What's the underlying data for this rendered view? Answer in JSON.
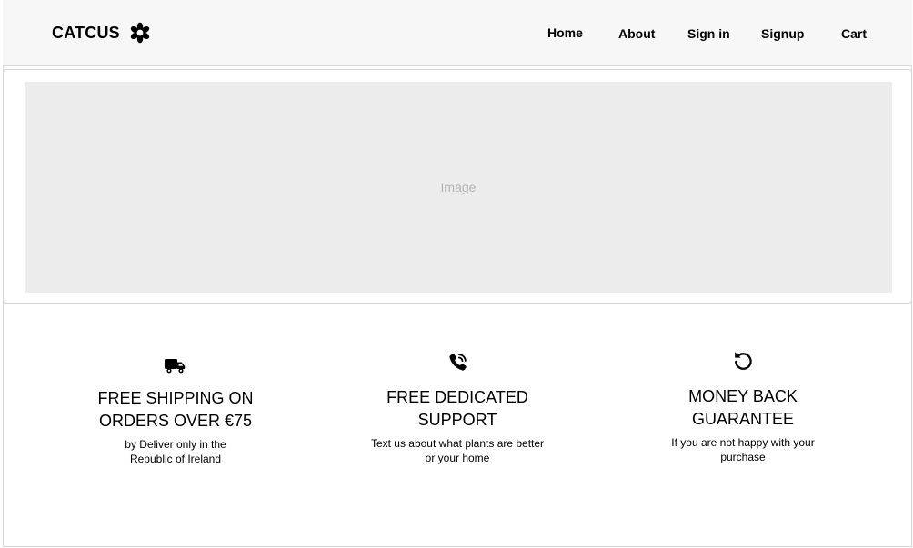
{
  "header": {
    "brand": "CATCUS",
    "brand_icon": "flower-icon",
    "nav": {
      "home": "Home",
      "about": "About",
      "signin": "Sign in",
      "signup": "Signup",
      "cart": "Cart"
    }
  },
  "hero": {
    "placeholder_label": "Image"
  },
  "features": [
    {
      "icon": "truck-icon",
      "title_line1": "FREE SHIPPING ON",
      "title_line2": "ORDERS OVER €75",
      "desc_line1": "by Deliver only in the",
      "desc_line2": "Republic of Ireland"
    },
    {
      "icon": "phone-call-icon",
      "title_line1": "FREE DEDICATED",
      "title_line2": "SUPPORT",
      "desc_line1": "Text us about what plants are better",
      "desc_line2": "or your home"
    },
    {
      "icon": "refresh-icon",
      "title_line1": "MONEY BACK",
      "title_line2": "GUARANTEE",
      "desc_line1": "If you are not happy with your",
      "desc_line2": "purchase"
    }
  ],
  "colors": {
    "navbar_bg": "#f7f7f7",
    "image_placeholder_bg": "#ececec",
    "text": "#000000"
  }
}
